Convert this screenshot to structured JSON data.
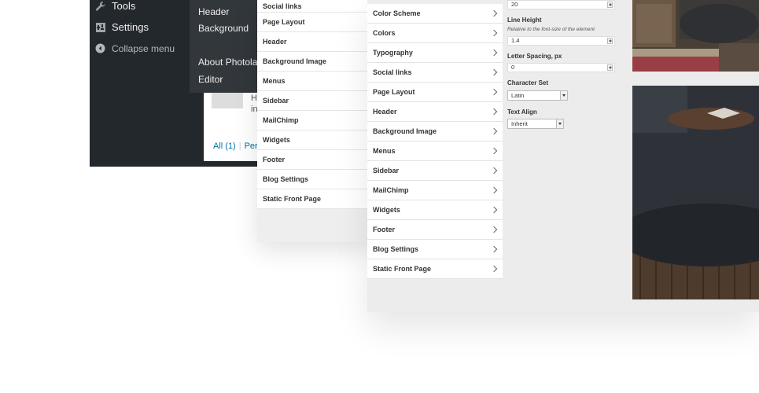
{
  "admin_menu": {
    "items": [
      {
        "label": "Tools",
        "icon": "wrench-icon"
      },
      {
        "label": "Settings",
        "icon": "settings-icon"
      }
    ],
    "collapse_label": "Collapse menu"
  },
  "flyout": {
    "items": [
      "Header",
      "Background"
    ],
    "items2": [
      "About Photolab",
      "Editor"
    ]
  },
  "comment": {
    "text_line1": "H",
    "text_line2": "in",
    "link_all": "All (1)",
    "link_next": "Per"
  },
  "panel1": {
    "items": [
      "Social links",
      "Page Layout",
      "Header",
      "Background Image",
      "Menus",
      "Sidebar",
      "MailChimp",
      "Widgets",
      "Footer",
      "Blog Settings",
      "Static Front Page"
    ]
  },
  "panel2": {
    "items": [
      "Color Scheme",
      "Colors",
      "Typography",
      "Social links",
      "Page Layout",
      "Header",
      "Background Image",
      "Menus",
      "Sidebar",
      "MailChimp",
      "Widgets",
      "Footer",
      "Blog Settings",
      "Static Front Page"
    ]
  },
  "settings": {
    "font_size_value": "20",
    "line_height_label": "Line Height",
    "line_height_hint": "Relative to the font-size of the element",
    "line_height_value": "1.4",
    "letter_spacing_label": "Letter Spacing, px",
    "letter_spacing_value": "0",
    "charset_label": "Character Set",
    "charset_value": "Latin",
    "align_label": "Text Align",
    "align_value": "Inherit"
  },
  "colors": {
    "admin_bg": "#23282d",
    "flyout_bg": "#32373c",
    "link": "#0073aa"
  }
}
